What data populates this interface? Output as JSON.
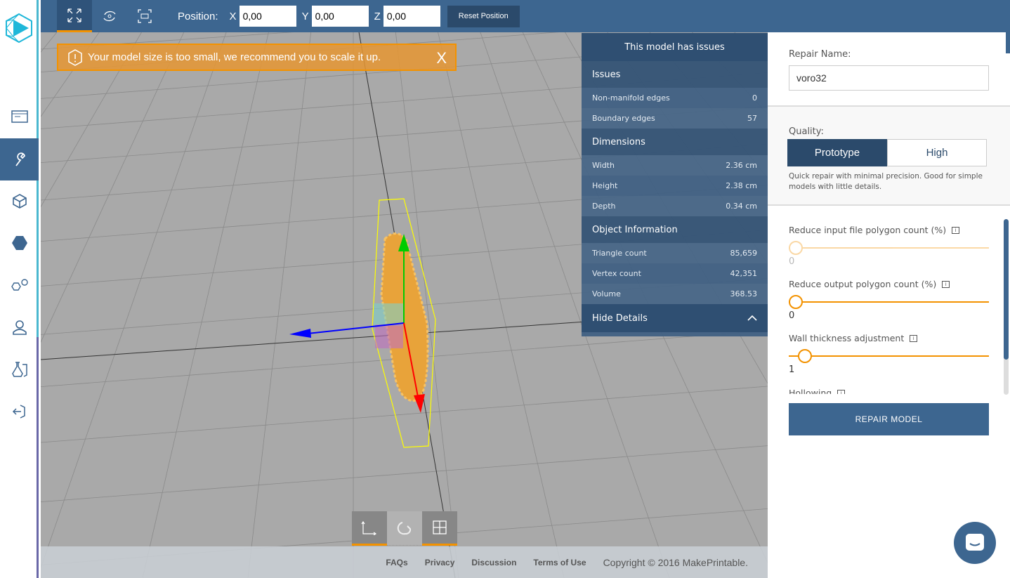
{
  "colors": {
    "primary": "#3d6690",
    "dark": "#2b4a6b",
    "accent": "#f39200",
    "logo": "#1fb7d9"
  },
  "sidebar": {
    "items": [
      {
        "icon": "browser-icon"
      },
      {
        "icon": "wrench-icon",
        "active": true
      },
      {
        "icon": "cube-icon"
      },
      {
        "icon": "hexagon-icon"
      },
      {
        "icon": "gears-icon"
      },
      {
        "icon": "user-icon"
      },
      {
        "icon": "lab-icon"
      },
      {
        "icon": "logout-icon"
      }
    ]
  },
  "toolbar": {
    "position_label": "Position:",
    "x_label": "X",
    "y_label": "Y",
    "z_label": "Z",
    "x": "0,00",
    "y": "0,00",
    "z": "0,00",
    "reset": "Reset Position"
  },
  "alert": {
    "text": "Your model size is too small, we recommend you to scale it up.",
    "close": "X"
  },
  "issues_panel": {
    "title": "This model has issues",
    "sections": [
      {
        "title": "Issues",
        "rows": [
          {
            "k": "Non-manifold edges",
            "v": "0"
          },
          {
            "k": "Boundary edges",
            "v": "57"
          }
        ]
      },
      {
        "title": "Dimensions",
        "rows": [
          {
            "k": "Width",
            "v": "2.36 cm"
          },
          {
            "k": "Height",
            "v": "2.38 cm"
          },
          {
            "k": "Depth",
            "v": "0.34 cm"
          }
        ]
      },
      {
        "title": "Object Information",
        "rows": [
          {
            "k": "Triangle count",
            "v": "85,659"
          },
          {
            "k": "Vertex count",
            "v": "42,351"
          },
          {
            "k": "Volume",
            "v": "368.53"
          }
        ]
      }
    ],
    "hide": "Hide Details"
  },
  "repair": {
    "name_label": "Repair Name:",
    "name": "voro32",
    "quality_label": "Quality:",
    "quality_options": [
      "Prototype",
      "High"
    ],
    "quality_selected": "Prototype",
    "quality_desc": "Quick repair with minimal precision. Good for simple models with little details.",
    "sliders": [
      {
        "label": "Reduce input file polygon count (%)",
        "value": "0",
        "level": 0,
        "disabled": true
      },
      {
        "label": "Reduce output polygon count (%)",
        "value": "0",
        "level": 0
      },
      {
        "label": "Wall thickness adjustment",
        "value": "1",
        "level": 0.05
      }
    ],
    "hollowing": "Hollowing",
    "button": "REPAIR MODEL"
  },
  "footer": {
    "links": [
      "FAQs",
      "Privacy",
      "Discussion",
      "Terms of Use"
    ],
    "copyright": "Copyright © 2016 MakePrintable."
  }
}
